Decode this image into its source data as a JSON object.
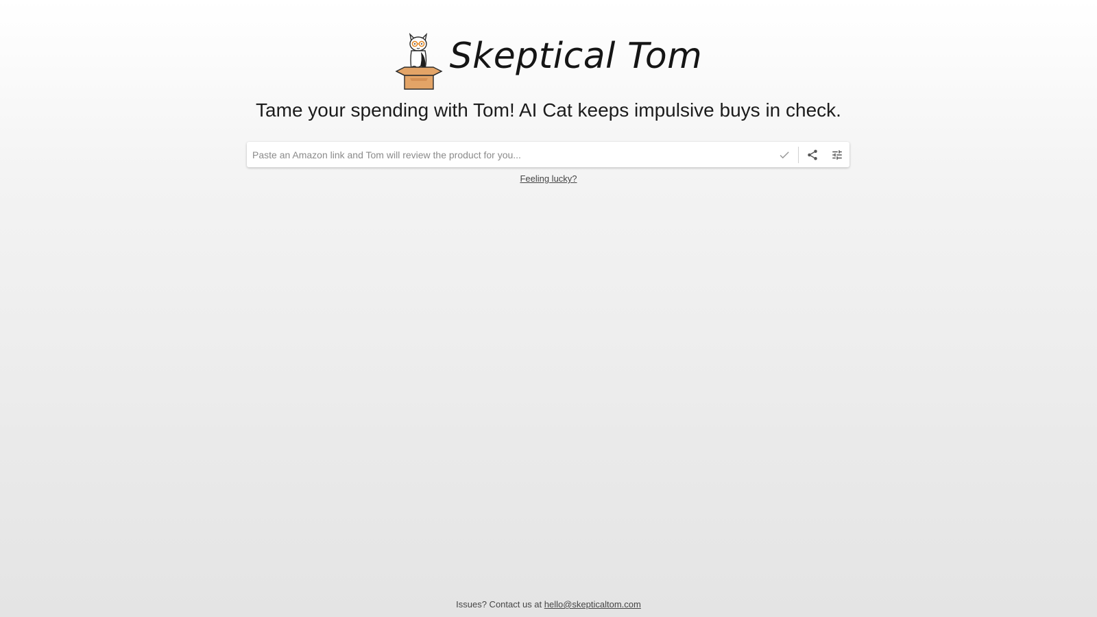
{
  "brand": {
    "name": "Skeptical Tom",
    "logo_icon": "cat-in-box-icon"
  },
  "tagline": "Tame your spending with Tom! AI Cat keeps impulsive buys in check.",
  "search": {
    "placeholder": "Paste an Amazon link and Tom will review the product for you...",
    "value": "",
    "icons": [
      "check-icon",
      "share-icon",
      "tune-icon"
    ]
  },
  "lucky_link": "Feeling lucky?",
  "footer": {
    "prefix": "Issues? Contact us at ",
    "email": "hello@skepticaltom.com"
  },
  "colors": {
    "box": "#e3a467",
    "box_stroke": "#2a2a2a",
    "glasses": "#e58b2a"
  }
}
